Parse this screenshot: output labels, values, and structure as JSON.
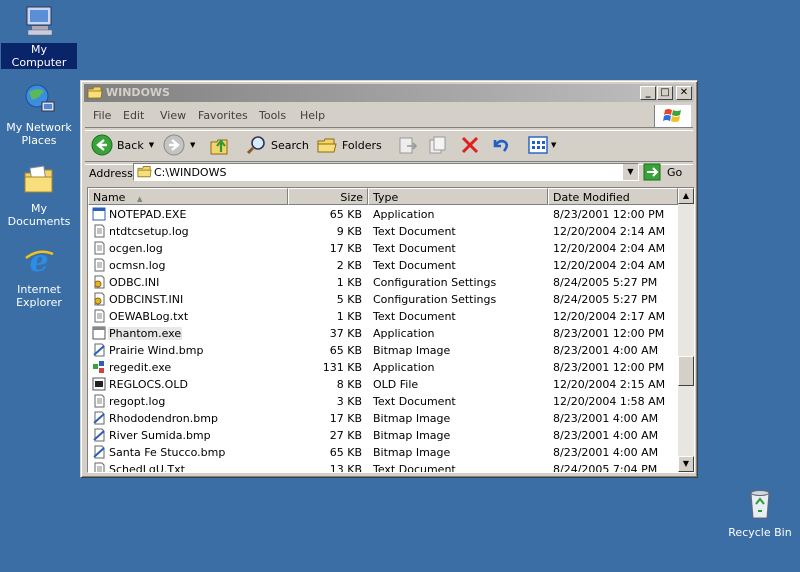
{
  "desktop": {
    "icons": [
      {
        "label": "My Computer"
      },
      {
        "label": "My Network Places"
      },
      {
        "label": "My Documents"
      },
      {
        "label": "Internet Explorer"
      },
      {
        "label": "Recycle Bin"
      }
    ]
  },
  "window": {
    "title": "WINDOWS",
    "controls": {
      "minimize": "_",
      "maximize": "□",
      "close": "✕"
    },
    "menu": [
      "File",
      "Edit",
      "View",
      "Favorites",
      "Tools",
      "Help"
    ],
    "toolbar": {
      "back_label": "Back",
      "search_label": "Search",
      "folders_label": "Folders"
    },
    "address": {
      "label": "Address",
      "value": "C:\\WINDOWS",
      "go_label": "Go"
    },
    "columns": [
      "Name",
      "Size",
      "Type",
      "Date Modified"
    ],
    "files": [
      {
        "name": "NOTEPAD.EXE",
        "size": "65 KB",
        "type": "Application",
        "date": "8/23/2001 12:00 PM",
        "icon": "app"
      },
      {
        "name": "ntdtcsetup.log",
        "size": "9 KB",
        "type": "Text Document",
        "date": "12/20/2004 2:14 AM",
        "icon": "text"
      },
      {
        "name": "ocgen.log",
        "size": "17 KB",
        "type": "Text Document",
        "date": "12/20/2004 2:04 AM",
        "icon": "text"
      },
      {
        "name": "ocmsn.log",
        "size": "2 KB",
        "type": "Text Document",
        "date": "12/20/2004 2:04 AM",
        "icon": "text"
      },
      {
        "name": "ODBC.INI",
        "size": "1 KB",
        "type": "Configuration Settings",
        "date": "8/24/2005 5:27 PM",
        "icon": "ini"
      },
      {
        "name": "ODBCINST.INI",
        "size": "5 KB",
        "type": "Configuration Settings",
        "date": "8/24/2005 5:27 PM",
        "icon": "ini"
      },
      {
        "name": "OEWABLog.txt",
        "size": "1 KB",
        "type": "Text Document",
        "date": "12/20/2004 2:17 AM",
        "icon": "text"
      },
      {
        "name": "Phantom.exe",
        "size": "37 KB",
        "type": "Application",
        "date": "8/23/2001 12:00 PM",
        "icon": "exe",
        "selected": true
      },
      {
        "name": "Prairie Wind.bmp",
        "size": "65 KB",
        "type": "Bitmap Image",
        "date": "8/23/2001 4:00 AM",
        "icon": "bmp"
      },
      {
        "name": "regedit.exe",
        "size": "131 KB",
        "type": "Application",
        "date": "8/23/2001 12:00 PM",
        "icon": "regedit"
      },
      {
        "name": "REGLOCS.OLD",
        "size": "8 KB",
        "type": "OLD File",
        "date": "12/20/2004 2:15 AM",
        "icon": "old"
      },
      {
        "name": "regopt.log",
        "size": "3 KB",
        "type": "Text Document",
        "date": "12/20/2004 1:58 AM",
        "icon": "text"
      },
      {
        "name": "Rhododendron.bmp",
        "size": "17 KB",
        "type": "Bitmap Image",
        "date": "8/23/2001 4:00 AM",
        "icon": "bmp"
      },
      {
        "name": "River Sumida.bmp",
        "size": "27 KB",
        "type": "Bitmap Image",
        "date": "8/23/2001 4:00 AM",
        "icon": "bmp"
      },
      {
        "name": "Santa Fe Stucco.bmp",
        "size": "65 KB",
        "type": "Bitmap Image",
        "date": "8/23/2001 4:00 AM",
        "icon": "bmp"
      },
      {
        "name": "SchedLgU.Txt",
        "size": "13 KB",
        "type": "Text Document",
        "date": "8/24/2005 7:04 PM",
        "icon": "text"
      }
    ],
    "scroll_position": 0.6
  },
  "colors": {
    "desktop": "#3a6ea5",
    "inactive_title": "#808080",
    "selection": "#0a246a"
  }
}
